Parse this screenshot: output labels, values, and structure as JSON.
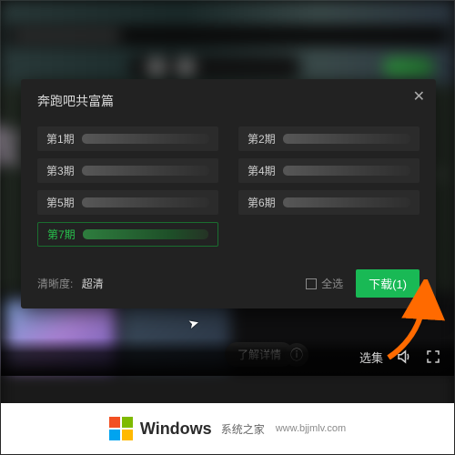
{
  "modal": {
    "title": "奔跑吧共富篇",
    "episodes": [
      {
        "label": "第1期",
        "selected": false
      },
      {
        "label": "第2期",
        "selected": false
      },
      {
        "label": "第3期",
        "selected": false
      },
      {
        "label": "第4期",
        "selected": false
      },
      {
        "label": "第5期",
        "selected": false
      },
      {
        "label": "第6期",
        "selected": false
      },
      {
        "label": "第7期",
        "selected": true
      }
    ],
    "clarity_label": "清晰度:",
    "clarity_value": "超清",
    "select_all": "全选",
    "download_btn": "下载(1)"
  },
  "player": {
    "detail_btn": "了解详情",
    "episodes_label": "选集"
  },
  "watermark": {
    "brand": "Windows",
    "brand_sub": "系统之家",
    "url": "www.bjjmlv.com"
  }
}
